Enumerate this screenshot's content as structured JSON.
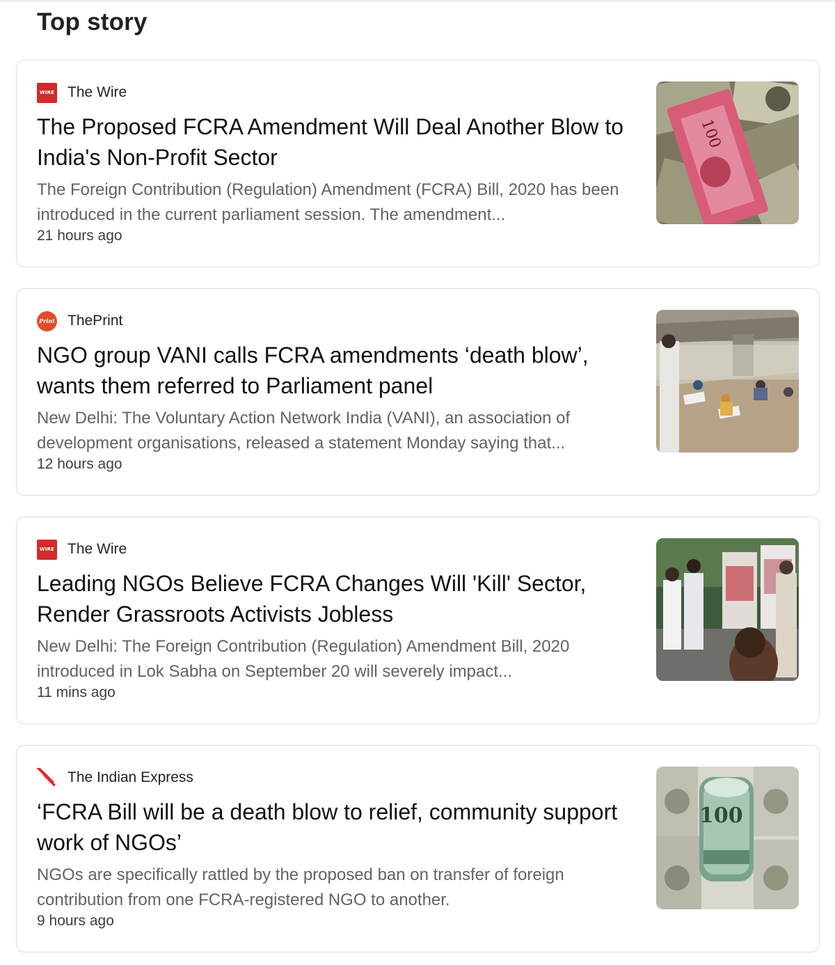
{
  "section_title": "Top story",
  "stories": [
    {
      "source": "The Wire",
      "source_icon": "the-wire-logo",
      "headline": "The Proposed FCRA Amendment Will Deal Another Blow to India's Non-Profit Sector",
      "snippet": "The Foreign Contribution (Regulation) Amendment (FCRA) Bill, 2020 has been introduced in the current parliament session. The amendment...",
      "time": "21 hours ago",
      "thumbnail": "currency-notes-image"
    },
    {
      "source": "ThePrint",
      "source_icon": "theprint-logo",
      "headline": "NGO group VANI calls FCRA amendments ‘death blow’, wants them referred to Parliament panel",
      "snippet": "New Delhi: The Voluntary Action Network India (VANI), an association of development organisations, released a statement Monday saying that...",
      "time": "12 hours ago",
      "thumbnail": "people-under-flyover-image"
    },
    {
      "source": "The Wire",
      "source_icon": "the-wire-logo",
      "headline": "Leading NGOs Believe FCRA Changes Will 'Kill' Sector, Render Grassroots Activists Jobless",
      "snippet": "New Delhi: The Foreign Contribution (Regulation) Amendment Bill, 2020 introduced in Lok Sabha on September 20 will severely impact...",
      "time": "11 mins ago",
      "thumbnail": "exhibition-visitors-image"
    },
    {
      "source": "The Indian Express",
      "source_icon": "indian-express-logo",
      "headline": "‘FCRA Bill will be a death blow to relief, community support work of NGOs’",
      "snippet": "NGOs are specifically rattled by the proposed ban on transfer of foreign contribution from one FCRA-registered NGO to another.",
      "time": "9 hours ago",
      "thumbnail": "dollar-roll-image"
    }
  ],
  "logo_text": {
    "wire": "WIRE",
    "print": "Print"
  },
  "colors": {
    "wire_red": "#d32a2a",
    "print_orange": "#e14d2a",
    "express_red": "#e8262b",
    "card_border": "#dadce0",
    "snippet_gray": "#5f6368"
  }
}
